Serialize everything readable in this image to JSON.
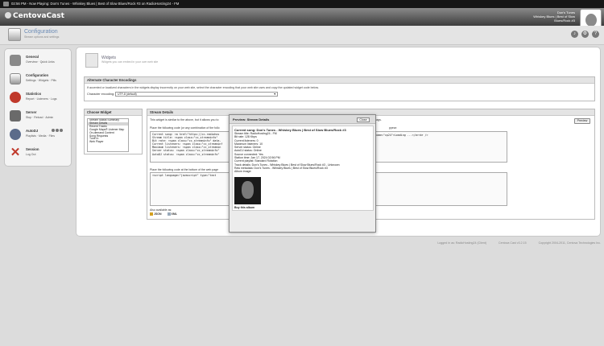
{
  "topbar": {
    "text": "02:56 PM  -  Now Playing: Don's Tunes - Whiskey Blues | Best of Slow Blues/Rock #3 on RadioHosting24 - FM"
  },
  "app": {
    "logo": "CentovaCast"
  },
  "user": {
    "name_line1": "Don's Tunes",
    "name_line2": "Whiskey Blues | Best of Slow",
    "name_line3": "Blues/Rock #3"
  },
  "page": {
    "title": "Configuration",
    "subtitle": "Stream options and settings"
  },
  "header_icons": [
    "headphones-icon",
    "settings-icon",
    "help-icon"
  ],
  "sidebar": {
    "items": [
      {
        "title": "General",
        "links": "Overview · Quick Links",
        "icon": "general-icon"
      },
      {
        "title": "Configuration",
        "links": "Settings · Widgets · Pills",
        "icon": "configuration-icon"
      },
      {
        "title": "Statistics",
        "links": "Report · Listeners · Logs",
        "icon": "statistics-icon"
      },
      {
        "title": "Server",
        "links": "Stop · Reload · Admin",
        "icon": "server-icon"
      },
      {
        "title": "AutoDJ",
        "links": "Playlists · Media · Files",
        "icon": "autodj-icon"
      },
      {
        "title": "Session",
        "links": "Log Out",
        "icon": "session-icon"
      }
    ]
  },
  "widgets": {
    "title": "Widgets",
    "subtitle": "Widgets you can embed in your own web site"
  },
  "encoding": {
    "header": "Alternate Character Encodings",
    "text": "If accented or localized characters in the widgets display incorrectly on your web site, select the character encoding that your web site uses and copy the updated widget code below.",
    "label": "Character encoding:",
    "value": "UTF-8 (default)"
  },
  "choose": {
    "header": "Choose Widget",
    "items": [
      "Stream Status Summary",
      "Stream Details",
      "Recent Tracks",
      "Google Maps® Listener Map",
      "On-demand Content",
      "Song Requests",
      "Tune In",
      "Web Player"
    ],
    "selected_index": 1
  },
  "details": {
    "header": "Stream Details",
    "desc": "This widget is similar to the above, but it allows you to",
    "desc2": "> tags.",
    "preview_label": "Preview",
    "instruction1": "Place the following code (or any combination of the follo",
    "instruction1b": "ppear:",
    "code1": "Current song: <a href=\"https://cc.radiohos\nStream title: <span class=\"cc_streaminfo\"\nBit rate: <span class=\"cc_streaminfo\" data-\nCurrent listeners: <span class=\"cc_streaminf\nMaximum listeners: <span class=\"cc_streamin\nServer status: <span class=\"cc_streaminfo\"\nAutoDJ status: <span class=\"cc_streaminfo\"",
    "code1b": "name=\"cp24\">Loading ...</a><br />",
    "instruction2": "Place the following code at the bottom of the web page",
    "code2": "<script language=\"javascript\" type=\"text",
    "also_label": "Also available as:",
    "formats": [
      "JSON",
      "XML"
    ]
  },
  "modal": {
    "title": "Preview: Stream Details",
    "close_label": "Close",
    "current_song": "Current song: Don's Tunes - Whiskey Blues | Best of Slow Blues/Rock #3",
    "rows": [
      "Stream title: RadioHosting24 - FM",
      "Bit rate: 128 Kbps",
      "Current listeners: 0",
      "Maximum listeners: 10",
      "Server status: Online",
      "AutoDJ status: Online",
      "Source connected: Yes",
      "Station time: Jan 17, 2024 02:56 PM",
      "Current playlist: Standard Rotation",
      "Track details: Don's Tunes - Whiskey Blues | Best of Slow Blues/Rock #3 - Unknown",
      "Raw metadata: Don's Tunes - Whiskey Blues | Best of Slow Blues/Rock #3",
      "Album image:"
    ],
    "buy_label": "Buy this album"
  },
  "footer": {
    "logged_in": "Logged in as: RadioHosting24 (Client)",
    "version": "Centova Cast v3.2.15",
    "copyright": "Copyright 2004-2011, Centova Technologies Inc."
  }
}
